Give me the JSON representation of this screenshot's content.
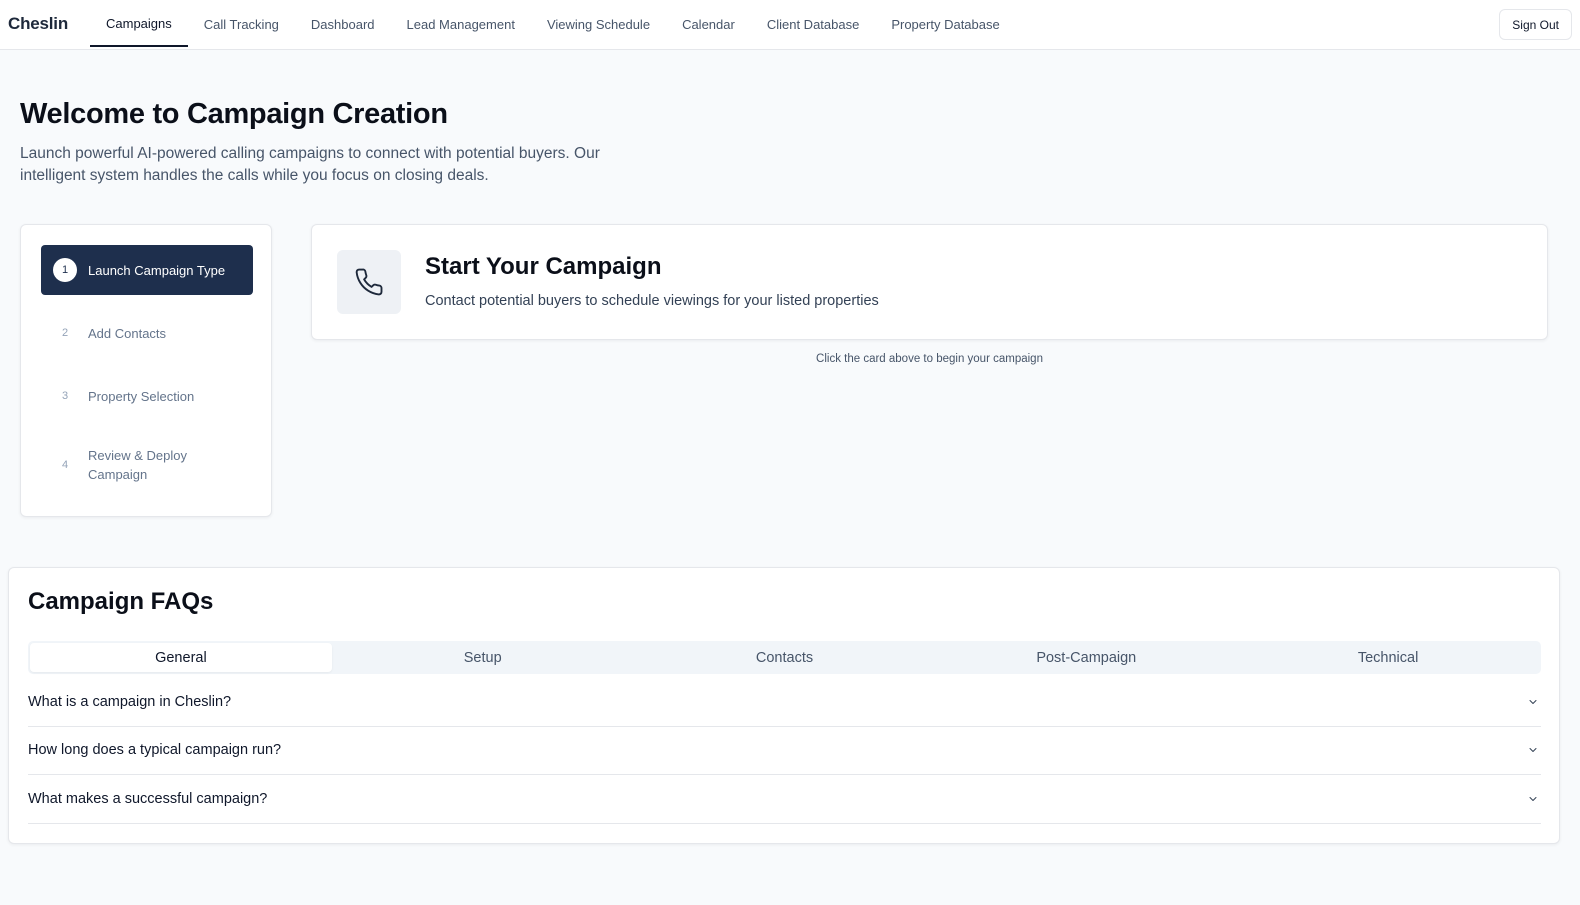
{
  "brand": "Cheslin",
  "nav": {
    "tabs": [
      {
        "label": "Campaigns",
        "active": true
      },
      {
        "label": "Call Tracking"
      },
      {
        "label": "Dashboard"
      },
      {
        "label": "Lead Management"
      },
      {
        "label": "Viewing Schedule"
      },
      {
        "label": "Calendar"
      },
      {
        "label": "Client Database"
      },
      {
        "label": "Property Database"
      }
    ],
    "sign_out": "Sign Out"
  },
  "hero": {
    "title": "Welcome to Campaign Creation",
    "description": "Launch powerful AI-powered calling campaigns to connect with potential buyers. Our intelligent system handles the calls while you focus on closing deals."
  },
  "steps": [
    {
      "number": "1",
      "label": "Launch Campaign Type",
      "active": true
    },
    {
      "number": "2",
      "label": "Add Contacts"
    },
    {
      "number": "3",
      "label": "Property Selection"
    },
    {
      "number": "4",
      "label": "Review & Deploy Campaign"
    }
  ],
  "campaign_card": {
    "icon": "phone-icon",
    "title": "Start Your Campaign",
    "description": "Contact potential buyers to schedule viewings for your listed properties"
  },
  "hint": "Click the card above to begin your campaign",
  "faq": {
    "title": "Campaign FAQs",
    "tabs": [
      {
        "label": "General",
        "active": true
      },
      {
        "label": "Setup"
      },
      {
        "label": "Contacts"
      },
      {
        "label": "Post-Campaign"
      },
      {
        "label": "Technical"
      }
    ],
    "items": [
      {
        "question": "What is a campaign in Cheslin?"
      },
      {
        "question": "How long does a typical campaign run?"
      },
      {
        "question": "What makes a successful campaign?"
      }
    ]
  },
  "colors": {
    "primary": "#1e2f4d",
    "background": "#f8fafc",
    "border": "#e5e7eb",
    "muted_text": "#64748b"
  }
}
